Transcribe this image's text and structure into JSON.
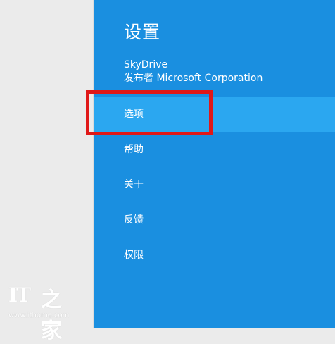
{
  "settings_panel": {
    "title": "设置",
    "app_name": "SkyDrive",
    "publisher": "发布者 Microsoft Corporation",
    "menu": [
      {
        "label": "选项",
        "selected": true
      },
      {
        "label": "帮助"
      },
      {
        "label": "关于"
      },
      {
        "label": "反馈"
      },
      {
        "label": "权限"
      }
    ]
  },
  "colors": {
    "panel_background": "#1a8fe0",
    "selected_item": "#2ba7f0",
    "highlight_outline": "#e01818",
    "left_pane": "#ebebeb"
  },
  "watermark": {
    "logo": "IT",
    "glyph": "之家",
    "url": "www.ithome.com"
  }
}
